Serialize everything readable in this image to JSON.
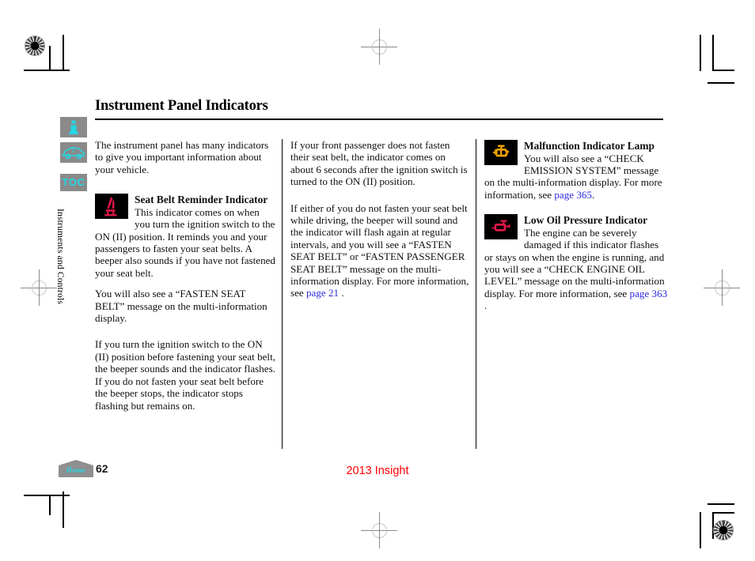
{
  "document": {
    "title": "Instrument Panel Indicators",
    "page_number": "62",
    "model_year": "2013 Insight"
  },
  "sidebar": {
    "info_icon": "info-icon",
    "vehicle_icon": "car-icon",
    "toc_label": "TOC",
    "section_label": "Instruments and Controls"
  },
  "footer": {
    "home_label": "Home",
    "home_icon": "house-icon"
  },
  "columns": {
    "column1": {
      "intro": "The instrument panel has many indicators to give you important information about your vehicle.",
      "indicator": {
        "icon": "seat-belt-reminder-icon",
        "title": "Seat Belt Reminder Indicator",
        "paragraph1": "This indicator comes on when you turn the ignition switch to the ON (II) position. It reminds you and your passengers to fasten your seat belts. A beeper also sounds if you have not fastened your seat belt.",
        "paragraph2": "You will also see a “FASTEN SEAT BELT” message on the multi-information display.",
        "paragraph3": "If you turn the ignition switch to the ON (II) position before fastening your seat belt, the beeper sounds and the indicator flashes. If you do not fasten your seat belt before the beeper stops, the indicator stops flashing but remains on."
      }
    },
    "column2": {
      "paragraph1": "If your front passenger does not fasten their seat belt, the indicator comes on about 6 seconds after the ignition switch is turned to the ON (II) position.",
      "paragraph2_before": "If either of you do not fasten your seat belt while driving, the beeper will sound and the indicator will flash again at regular intervals, and you will see a “FASTEN SEAT BELT” or “FASTEN PASSENGER SEAT BELT” message on the multi-information display. For more information, see ",
      "paragraph2_link": "page  21",
      "paragraph2_after": " ."
    },
    "column3": {
      "indicator1": {
        "icon": "malfunction-indicator-lamp-icon",
        "title": "Malfunction Indicator Lamp",
        "body_before": "You will also see a “CHECK EMISSION SYSTEM” message on the multi-information display. For more information, see ",
        "body_link": "page  365",
        "body_after": "."
      },
      "indicator2": {
        "icon": "low-oil-pressure-icon",
        "title": "Low Oil Pressure Indicator",
        "body_before": "The engine can be severely damaged if this indicator flashes or stays on when the engine is running, and you will see a “CHECK ENGINE OIL LEVEL” message on the multi-information display. For more information, see ",
        "body_link": "page 363",
        "body_after": " ."
      }
    }
  },
  "colors": {
    "link": "#2a2ae0",
    "model_year": "#ff0000",
    "accent_cyan": "#22d7e6",
    "sidebar_gray": "#8a8a8a",
    "seat_belt_red": "#e8174a",
    "mil_amber": "#f5a201",
    "oil_red": "#e8174a"
  }
}
